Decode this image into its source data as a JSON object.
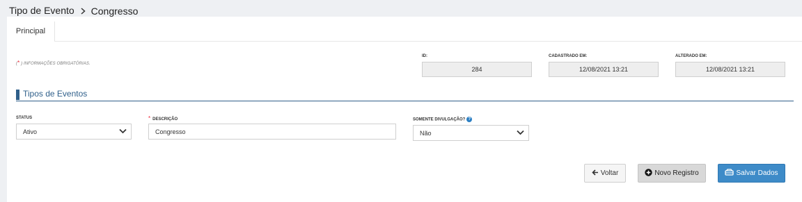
{
  "breadcrumb": {
    "parent": "Tipo de Evento",
    "current": "Congresso"
  },
  "tabs": [
    {
      "label": "Principal"
    }
  ],
  "required_note": {
    "star": "*",
    "text": ") INFORMAÇÕES OBRIGATÓRIAS."
  },
  "meta": {
    "id_label": "ID:",
    "id_value": "284",
    "created_label": "CADASTRADO EM:",
    "created_value": "12/08/2021 13:21",
    "updated_label": "ALTERADO EM:",
    "updated_value": "12/08/2021 13:21"
  },
  "section": {
    "title": "Tipos de Eventos"
  },
  "form": {
    "status_label": "STATUS",
    "status_value": "Ativo",
    "descricao_label": "DESCRIÇÃO",
    "descricao_value": "Congresso",
    "divulgacao_label": "SOMENTE DIVULGAÇÃO?",
    "divulgacao_value": "Não"
  },
  "buttons": {
    "voltar": "Voltar",
    "novo": "Novo Registro",
    "salvar": "Salvar Dados"
  },
  "colors": {
    "accent": "#2f5f8a",
    "primary_button": "#3e8bc8",
    "required": "#e23333"
  },
  "icons": [
    "chevron-right-icon",
    "chevron-down-icon",
    "help-icon",
    "arrow-left-icon",
    "plus-circle-icon",
    "save-icon"
  ]
}
